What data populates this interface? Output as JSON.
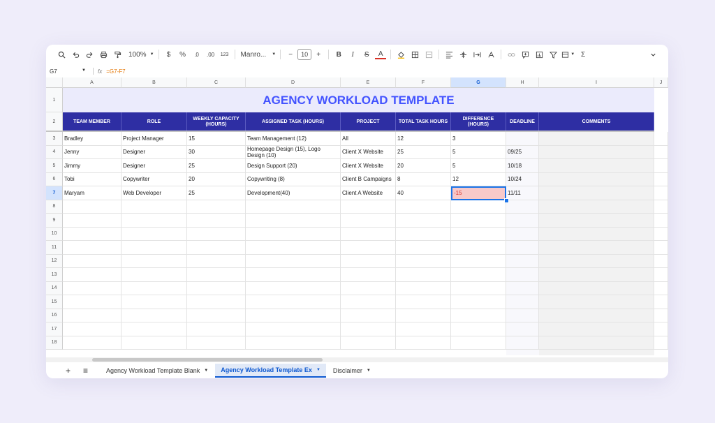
{
  "toolbar": {
    "zoom": "100%",
    "currency": "$",
    "percent": "%",
    "dec_dec": ".0",
    "dec_inc": ".00",
    "num_format": "123",
    "font": "Manro...",
    "font_size": "10",
    "bold": "B",
    "italic": "I",
    "strike": "S",
    "text_color": "A"
  },
  "formula_bar": {
    "cell_ref": "G7",
    "fx": "fx",
    "formula": "=G7-F7"
  },
  "columns": [
    "A",
    "B",
    "C",
    "D",
    "E",
    "F",
    "G",
    "H",
    "I",
    "J"
  ],
  "rows": [
    "1",
    "2",
    "3",
    "4",
    "5",
    "6",
    "7",
    "8",
    "9",
    "10",
    "11",
    "12",
    "13",
    "14",
    "15",
    "16",
    "17",
    "18"
  ],
  "sheet": {
    "title": "AGENCY WORKLOAD TEMPLATE",
    "headers": [
      "TEAM MEMBER",
      "ROLE",
      "WEEKLY CAPACITY (HOURS)",
      "ASSIGNED TASK (HOURS)",
      "PROJECT",
      "TOTAL TASK HOURS",
      "DIFFERENCE (HOURS)",
      "DEADLINE",
      "COMMENTS"
    ],
    "data": [
      [
        "Bradley",
        "Project Manager",
        "15",
        "Team Management (12)",
        "All",
        "12",
        "3",
        ""
      ],
      [
        "Jenny",
        "Designer",
        "30",
        "Homepage Design (15), Logo Design (10)",
        "Client X Website",
        "25",
        "5",
        "09/25"
      ],
      [
        "Jimmy",
        "Designer",
        "25",
        "Design Support (20)",
        "Client X Website",
        "20",
        "5",
        "10/18"
      ],
      [
        "Tobi",
        "Copywriter",
        "20",
        "Copywriting (8)",
        "Client B Campaigns",
        "8",
        "12",
        "10/24"
      ],
      [
        "Maryam",
        "Web Developer",
        "25",
        "Development(40)",
        "Client A Website",
        "40",
        "-15",
        "11/11"
      ]
    ]
  },
  "tabs": [
    "Agency Workload Template Blank",
    "Agency Workload Template Ex",
    "Disclaimer"
  ],
  "colors": {
    "header_bg": "#2e2ea3",
    "title_text": "#4353ff",
    "title_bg": "#ebebfc",
    "negative_bg": "#f8c9c9",
    "selection": "#1a73e8"
  }
}
